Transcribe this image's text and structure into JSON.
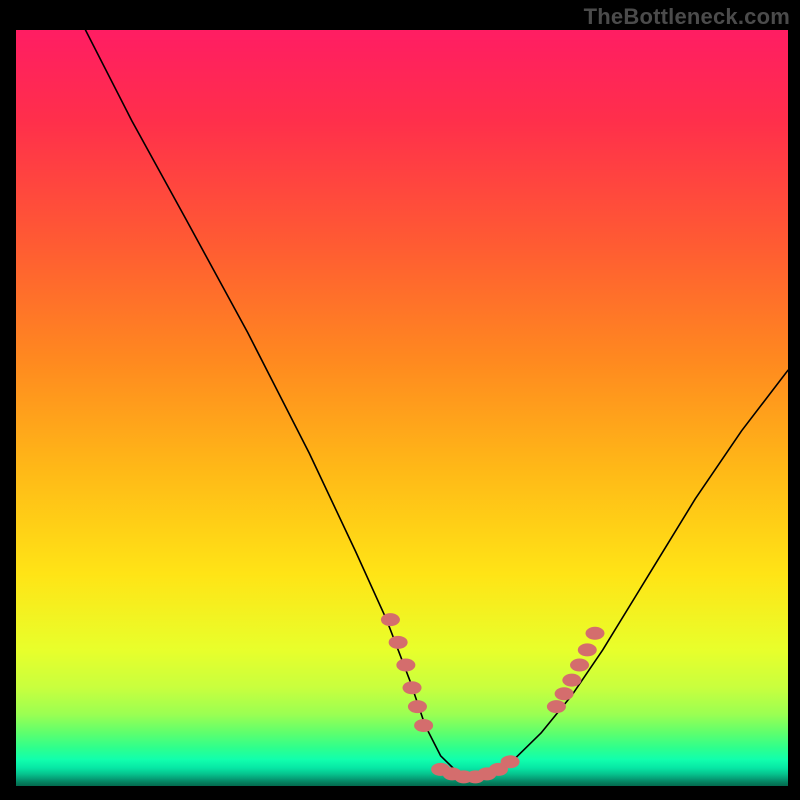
{
  "brand": {
    "watermark": "TheBottleneck.com"
  },
  "chart_data": {
    "type": "line",
    "title": "",
    "xlabel": "",
    "ylabel": "",
    "xlim": [
      0,
      100
    ],
    "ylim": [
      0,
      100
    ],
    "grid": false,
    "series": [
      {
        "name": "bottleneck-curve",
        "x": [
          9,
          15,
          22,
          30,
          38,
          44,
          48,
          51,
          53,
          55,
          57,
          59,
          61,
          64,
          68,
          72,
          76,
          82,
          88,
          94,
          100
        ],
        "y": [
          100,
          88,
          75,
          60,
          44,
          31,
          22,
          14,
          8,
          4,
          2,
          1,
          1.5,
          3,
          7,
          12,
          18,
          28,
          38,
          47,
          55
        ]
      },
      {
        "name": "sample-dots-left",
        "x": [
          48.5,
          49.5,
          50.5,
          51.3,
          52.0,
          52.8
        ],
        "y": [
          22.0,
          19.0,
          16.0,
          13.0,
          10.5,
          8.0
        ]
      },
      {
        "name": "sample-dots-valley",
        "x": [
          55.0,
          56.5,
          58.0,
          59.5,
          61.0,
          62.5,
          64.0
        ],
        "y": [
          2.2,
          1.6,
          1.2,
          1.2,
          1.6,
          2.2,
          3.2
        ]
      },
      {
        "name": "sample-dots-right",
        "x": [
          70.0,
          71.0,
          72.0,
          73.0,
          74.0,
          75.0
        ],
        "y": [
          10.5,
          12.2,
          14.0,
          16.0,
          18.0,
          20.2
        ]
      }
    ],
    "gradient_stops": [
      {
        "pos": 0.0,
        "color": "#ff1d63"
      },
      {
        "pos": 0.28,
        "color": "#ff5a33"
      },
      {
        "pos": 0.58,
        "color": "#ffb817"
      },
      {
        "pos": 0.82,
        "color": "#e8ff2b"
      },
      {
        "pos": 0.95,
        "color": "#2dff8e"
      },
      {
        "pos": 1.0,
        "color": "#036a4e"
      }
    ]
  }
}
